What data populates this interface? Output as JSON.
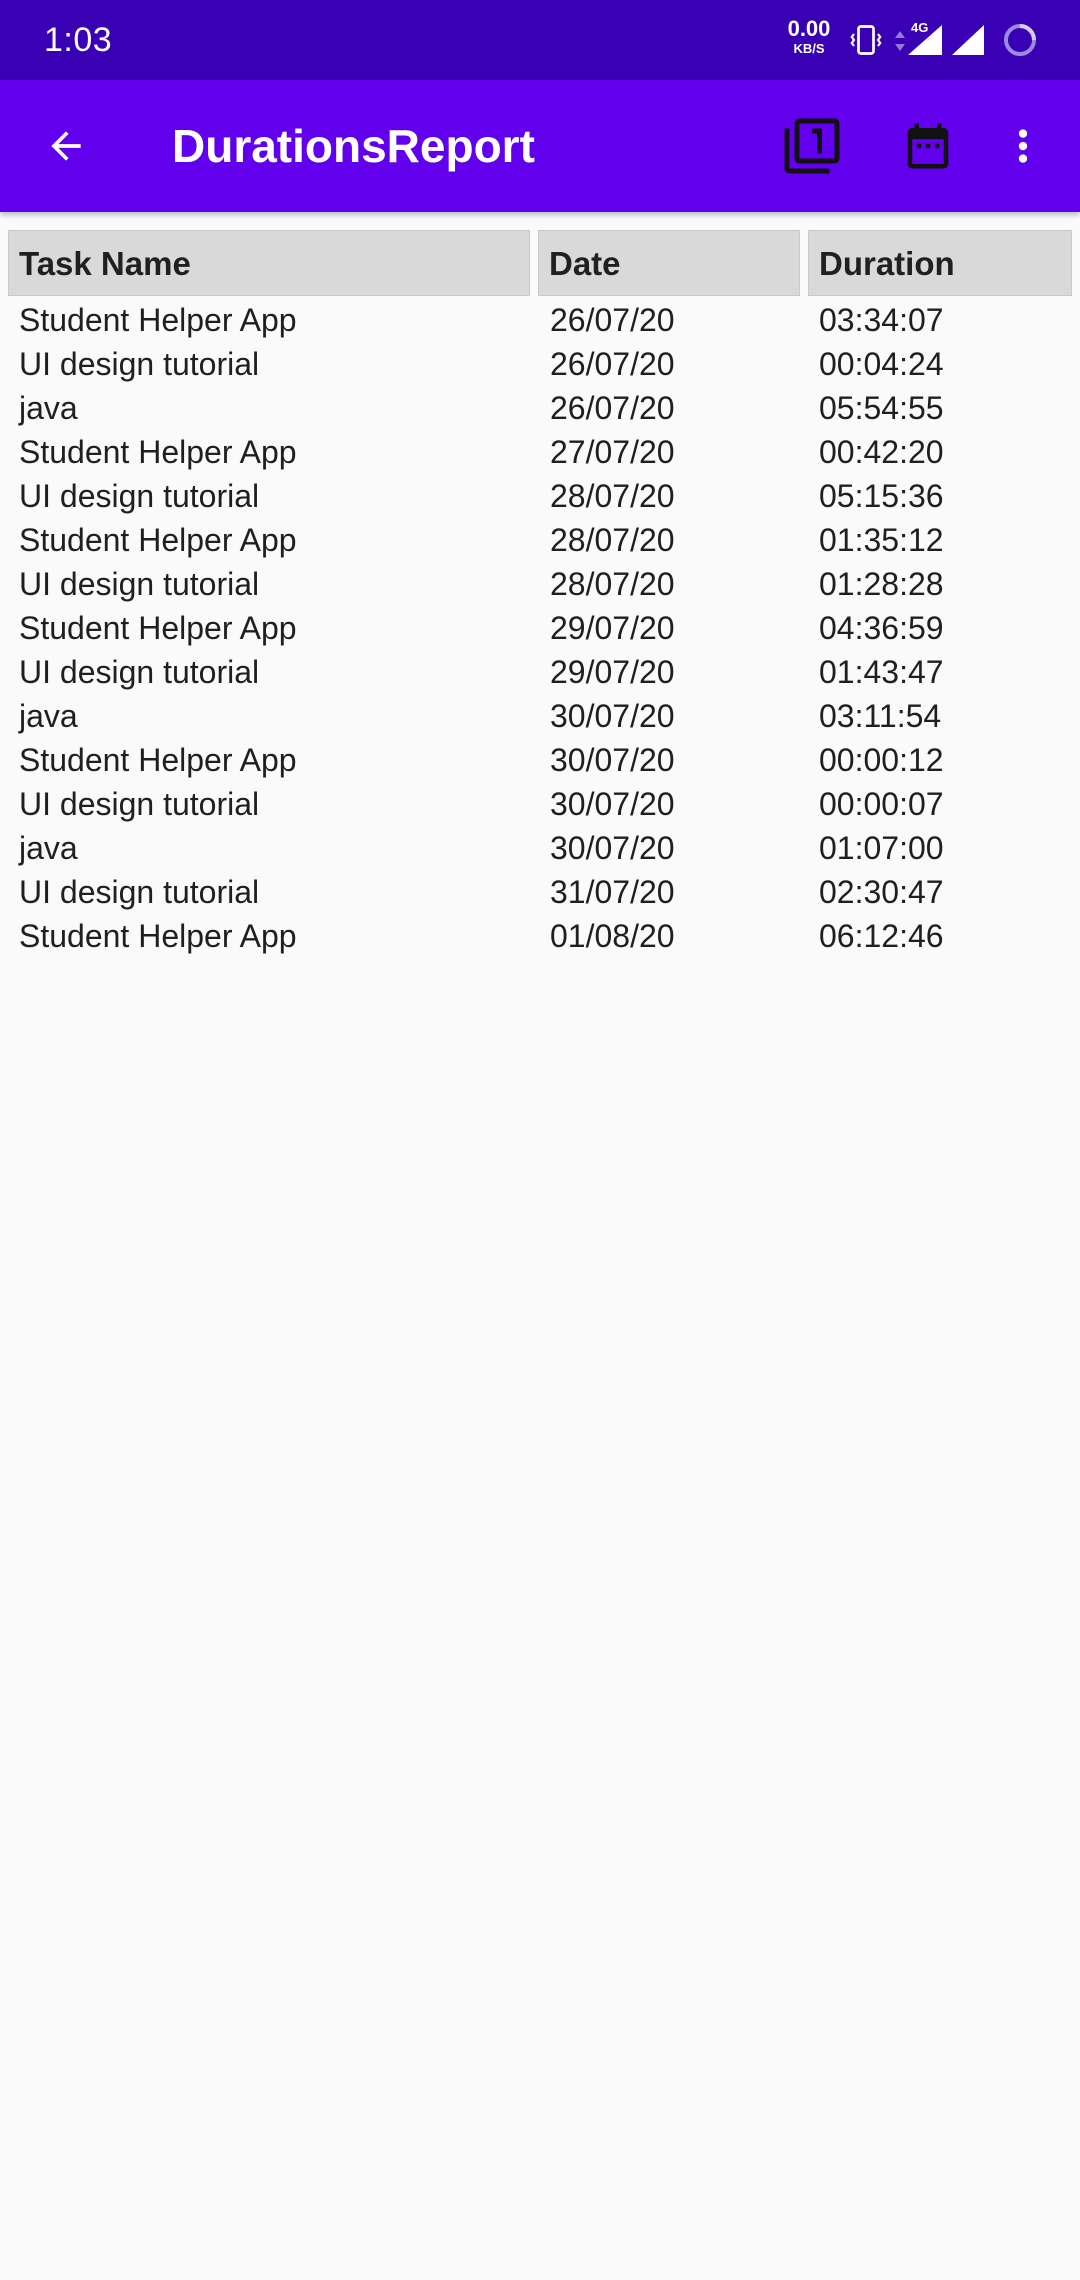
{
  "status_bar": {
    "time": "1:03",
    "net_speed_value": "0.00",
    "net_speed_unit": "KB/S",
    "network_type": "4G",
    "icons": [
      "vibrate-icon",
      "data-arrows-icon",
      "signal-4g-icon",
      "signal-icon",
      "battery-saver-ring-icon"
    ]
  },
  "app_bar": {
    "title": "DurationsReport",
    "actions": [
      "filter-one-icon",
      "calendar-icon",
      "more-vert-icon"
    ]
  },
  "table": {
    "headers": [
      "Task Name",
      "Date",
      "Duration"
    ],
    "rows": [
      [
        "Student Helper App",
        "26/07/20",
        "03:34:07"
      ],
      [
        "UI design tutorial",
        "26/07/20",
        "00:04:24"
      ],
      [
        "java",
        "26/07/20",
        "05:54:55"
      ],
      [
        "Student Helper App",
        "27/07/20",
        "00:42:20"
      ],
      [
        "UI design tutorial",
        "28/07/20",
        "05:15:36"
      ],
      [
        "Student Helper App",
        "28/07/20",
        "01:35:12"
      ],
      [
        "UI design tutorial",
        "28/07/20",
        "01:28:28"
      ],
      [
        "Student Helper App",
        "29/07/20",
        "04:36:59"
      ],
      [
        "UI design tutorial",
        "29/07/20",
        "01:43:47"
      ],
      [
        "java",
        "30/07/20",
        "03:11:54"
      ],
      [
        "Student Helper App",
        "30/07/20",
        "00:00:12"
      ],
      [
        "UI design tutorial",
        "30/07/20",
        "00:00:07"
      ],
      [
        "java",
        "30/07/20",
        "01:07:00"
      ],
      [
        "UI design tutorial",
        "31/07/20",
        "02:30:47"
      ],
      [
        "Student Helper App",
        "01/08/20",
        "06:12:46"
      ]
    ]
  },
  "colors": {
    "status_bar": "#3a00b4",
    "app_bar": "#6200ee",
    "header_cell": "#d8d9d8",
    "background": "#fafafa"
  }
}
